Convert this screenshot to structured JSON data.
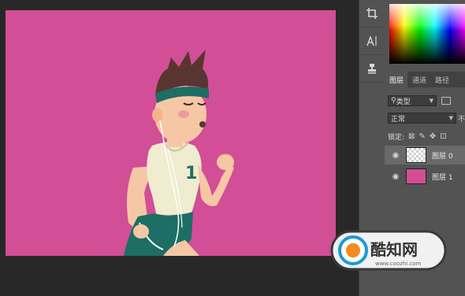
{
  "tools": [
    {
      "name": "crop-tool-icon",
      "glyph": "⌗"
    },
    {
      "name": "text-tool-icon",
      "glyph": "A|"
    },
    {
      "name": "stamp-tool-icon",
      "glyph": "⛊"
    }
  ],
  "colors": {
    "canvas_bg": "#d24e96",
    "panel_bg": "#535353",
    "workspace_bg": "#282828"
  },
  "panel": {
    "tabs": [
      "图层",
      "通道",
      "路径"
    ],
    "filter": {
      "icon": "⚲",
      "label": "类型"
    },
    "blend_mode": "正常",
    "opacity_hint": "不",
    "lock_label": "锁定:",
    "layers": [
      {
        "name": "图层 0",
        "selected": true,
        "thumb": "transparent-checker"
      },
      {
        "name": "图层 1",
        "selected": false,
        "thumb": "pink-fill"
      }
    ]
  },
  "watermark": {
    "brand": "酷知网",
    "url": "www.coozhi.com"
  }
}
